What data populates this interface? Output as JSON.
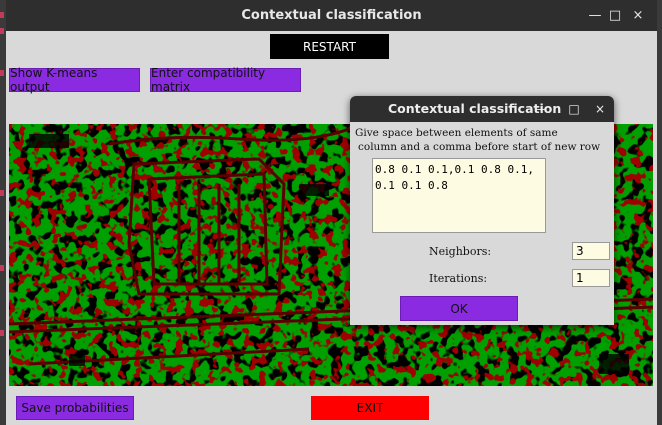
{
  "window": {
    "title": "Contextual classification",
    "controls": [
      "—",
      "□",
      "×"
    ]
  },
  "toolbar": {
    "restart_label": "RESTART",
    "kmeans_label": "Show K-means output",
    "compat_label": "Enter compatibility matrix"
  },
  "footer": {
    "save_label": "Save probabilities",
    "exit_label": "EXIT"
  },
  "map": {
    "description_colors": {
      "background": "#00a000",
      "class_a": "#5a0000",
      "class_b": "#000000"
    }
  },
  "dialog": {
    "title": "Contextual classification",
    "instructions": [
      "Give space between elements of same",
      "column and a comma before start of new row"
    ],
    "matrix_value": "0.8 0.1 0.1,0.1 0.8 0.1,0.1 0.1 0.8",
    "neighbors_label": "Neighbors:",
    "neighbors_value": "3",
    "iterations_label": "Iterations:",
    "iterations_value": "1",
    "ok_label": "OK"
  },
  "colors": {
    "accent_purple": "#8a2be2",
    "exit_red": "#ff0000",
    "titlebar": "#2e2e2e"
  }
}
